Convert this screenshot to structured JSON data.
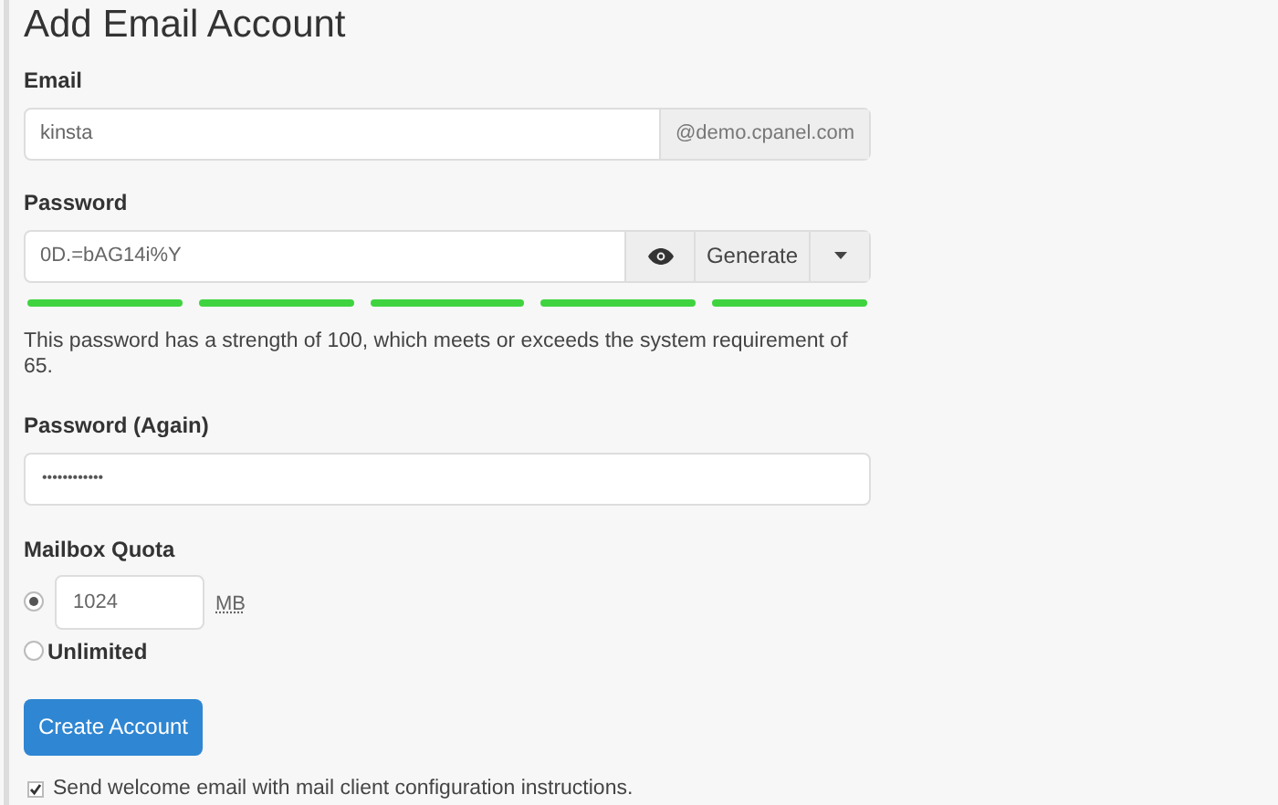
{
  "title": "Add Email Account",
  "email": {
    "label": "Email",
    "value": "kinsta",
    "domain": "@demo.cpanel.com"
  },
  "password": {
    "label": "Password",
    "value": "0D.=bAG14i%Y",
    "generate": "Generate",
    "strength_segments": [
      {
        "filled": true
      },
      {
        "filled": true
      },
      {
        "filled": true
      },
      {
        "filled": true
      },
      {
        "filled": true
      }
    ],
    "message": "This password has a strength of 100, which meets or exceeds the system requirement of 65."
  },
  "password_again": {
    "label": "Password (Again)",
    "value": "••••••••••••"
  },
  "quota": {
    "label": "Mailbox Quota",
    "options": [
      {
        "kind": "amount",
        "value": "1024",
        "unit": "MB",
        "selected": true
      },
      {
        "kind": "unlimited",
        "label": "Unlimited",
        "selected": false
      }
    ]
  },
  "create_button": "Create Account",
  "welcome": {
    "label": "Send welcome email with mail client configuration instructions.",
    "checked": true
  }
}
